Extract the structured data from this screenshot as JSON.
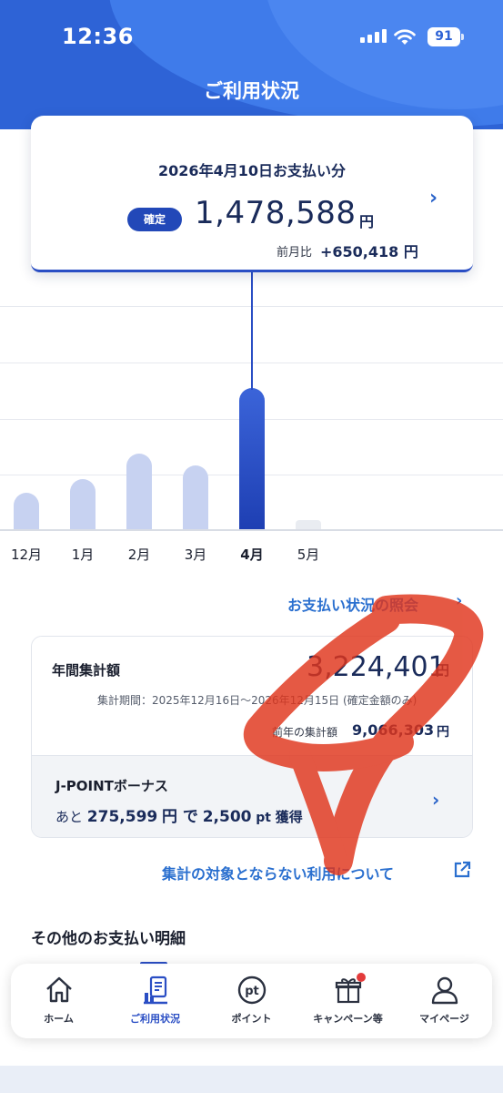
{
  "status_bar": {
    "time": "12:36",
    "battery": "91"
  },
  "header": {
    "title": "ご利用状況"
  },
  "summary": {
    "date_label": "2026年4月10日お支払い分",
    "badge": "確定",
    "amount": "1,478,588",
    "unit": "円",
    "prev_label": "前月比",
    "prev_value": "+650,418 円"
  },
  "chart_data": {
    "type": "bar",
    "categories": [
      "12月",
      "1月",
      "2月",
      "3月",
      "4月",
      "5月"
    ],
    "values": [
      380000,
      520000,
      790000,
      670000,
      1478588,
      0
    ],
    "highlighted": "4月",
    "grid": true,
    "active_color": "#2a4ec4",
    "inactive_color": "#c7d2f1"
  },
  "links": {
    "payment_status": "お支払い状況の照会",
    "excluded_usage": "集計の対象とならない利用について"
  },
  "annual": {
    "label": "年間集計額",
    "amount": "3,224,401",
    "unit": "円",
    "period": "集計期間：2025年12月16日〜2026年12月15日 (確定金額のみ)",
    "prev_label": "前年の集計額",
    "prev_amount": "9,066,303",
    "prev_unit": "円"
  },
  "jpoint": {
    "title": "J-POINTボーナス",
    "prefix": "あと",
    "remaining": "275,599",
    "unit1": "円 で",
    "points": "2,500",
    "unit2": "pt",
    "suffix": "獲得"
  },
  "other_section": {
    "title": "その他のお支払い明細"
  },
  "tabs": [
    {
      "label": "ホーム",
      "icon": "home-icon"
    },
    {
      "label": "ご利用状況",
      "icon": "usage-icon",
      "active": true
    },
    {
      "label": "ポイント",
      "icon": "points-icon"
    },
    {
      "label": "キャンペーン等",
      "icon": "gift-icon",
      "badge": true
    },
    {
      "label": "マイページ",
      "icon": "person-icon"
    }
  ]
}
